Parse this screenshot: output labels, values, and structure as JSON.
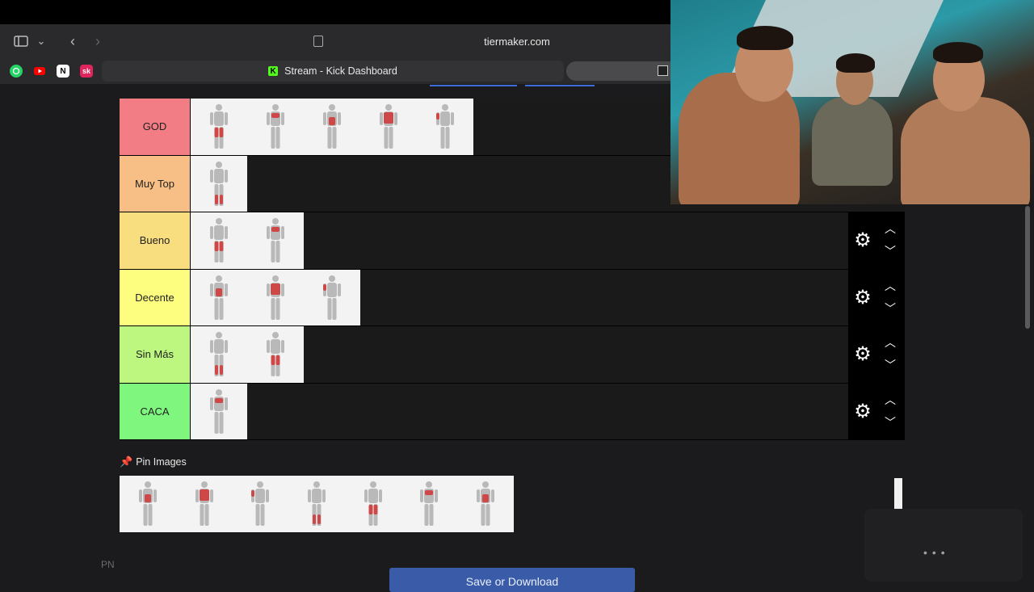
{
  "browser": {
    "url": "tiermaker.com",
    "tab_title": "Stream - Kick Dashboard",
    "kick_logo_letter": "K",
    "favicons": [
      "whatsapp-icon",
      "youtube-icon",
      "notion-icon",
      "sk-icon"
    ],
    "notion_letter": "N",
    "sk_letter": "sk"
  },
  "tiers": [
    {
      "label": "GOD",
      "color": "#f27d85",
      "items": 5
    },
    {
      "label": "Muy Top",
      "color": "#f7bf85",
      "items": 1
    },
    {
      "label": "Bueno",
      "color": "#f8de7f",
      "items": 2
    },
    {
      "label": "Decente",
      "color": "#fdfd7f",
      "items": 3
    },
    {
      "label": "Sin Más",
      "color": "#bdf77f",
      "items": 2
    },
    {
      "label": "CACA",
      "color": "#7ff77f",
      "items": 1
    }
  ],
  "pin": {
    "title": "Pin Images",
    "items": 7
  },
  "save_button": "Save or Download",
  "footer_left": "PN",
  "accent": "#d13434"
}
